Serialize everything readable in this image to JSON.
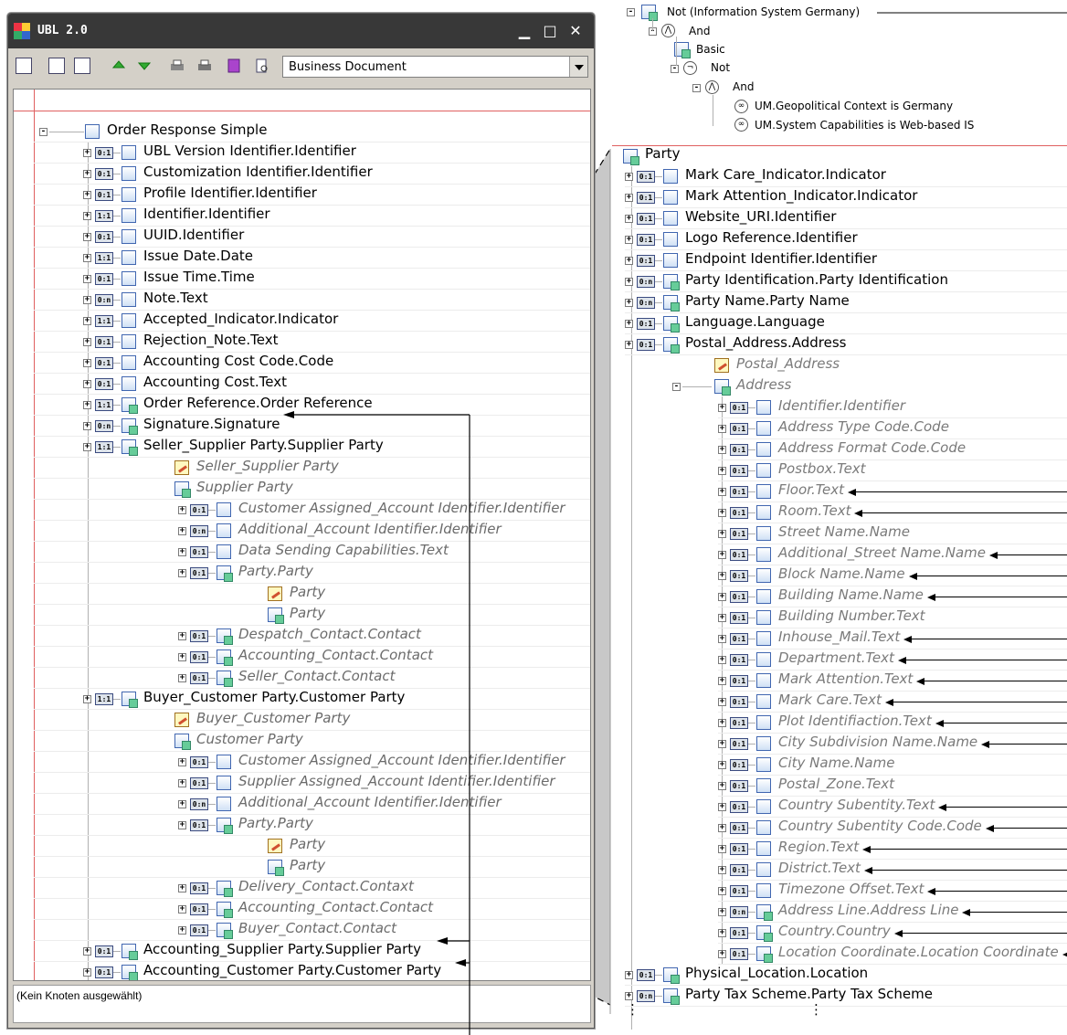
{
  "window": {
    "title": "UBL 2.0",
    "minimize": "▁",
    "maximize": "□",
    "close": "✕",
    "toolbar_icons": [
      "expand-all-icon",
      "collapse-all-icon",
      "expand-icon",
      "move-up-icon",
      "move-down-icon",
      "print-icon",
      "print-preview-icon",
      "book-icon",
      "document-view-icon"
    ],
    "document_type": "Business Document",
    "status": "(Kein Knoten ausgewählt)"
  },
  "tree": {
    "root": "Order Response Simple",
    "items": [
      {
        "card": "0:1",
        "label": "UBL Version Identifier.Identifier"
      },
      {
        "card": "0:1",
        "label": "Customization Identifier.Identifier"
      },
      {
        "card": "0:1",
        "label": "Profile Identifier.Identifier"
      },
      {
        "card": "1:1",
        "label": "Identifier.Identifier"
      },
      {
        "card": "0:1",
        "label": "UUID.Identifier"
      },
      {
        "card": "1:1",
        "label": "Issue Date.Date"
      },
      {
        "card": "0:1",
        "label": "Issue Time.Time"
      },
      {
        "card": "0:n",
        "label": "Note.Text"
      },
      {
        "card": "1:1",
        "label": "Accepted_Indicator.Indicator"
      },
      {
        "card": "0:1",
        "label": "Rejection_Note.Text"
      },
      {
        "card": "0:1",
        "label": "Accounting Cost Code.Code"
      },
      {
        "card": "0:1",
        "label": "Accounting Cost.Text"
      },
      {
        "card": "1:1",
        "label": "Order Reference.Order Reference"
      },
      {
        "card": "0:n",
        "label": "Signature.Signature"
      },
      {
        "card": "1:1",
        "label": "Seller_Supplier Party.Supplier Party"
      }
    ],
    "seller": {
      "ed_label": "Seller_Supplier Party",
      "bie_label": "Supplier Party",
      "children": [
        {
          "card": "0:1",
          "label": "Customer Assigned_Account Identifier.Identifier"
        },
        {
          "card": "0:n",
          "label": "Additional_Account Identifier.Identifier"
        },
        {
          "card": "0:1",
          "label": "Data Sending Capabilities.Text"
        },
        {
          "card": "0:1",
          "label": "Party.Party"
        }
      ],
      "party_ed": "Party",
      "party_bie": "Party",
      "children2": [
        {
          "card": "0:1",
          "label": "Despatch_Contact.Contact"
        },
        {
          "card": "0:1",
          "label": "Accounting_Contact.Contact"
        },
        {
          "card": "0:1",
          "label": "Seller_Contact.Contact"
        }
      ]
    },
    "buyer_item": {
      "card": "1:1",
      "label": "Buyer_Customer Party.Customer Party"
    },
    "buyer": {
      "ed_label": "Buyer_Customer Party",
      "bie_label": "Customer Party",
      "children": [
        {
          "card": "0:1",
          "label": "Customer Assigned_Account Identifier.Identifier"
        },
        {
          "card": "0:1",
          "label": "Supplier Assigned_Account Identifier.Identifier"
        },
        {
          "card": "0:n",
          "label": "Additional_Account Identifier.Identifier"
        },
        {
          "card": "0:1",
          "label": "Party.Party"
        }
      ],
      "party_ed": "Party",
      "party_bie": "Party",
      "children2": [
        {
          "card": "0:1",
          "label": "Delivery_Contact.Contaxt"
        },
        {
          "card": "0:1",
          "label": "Accounting_Contact.Contact"
        },
        {
          "card": "0:1",
          "label": "Buyer_Contact.Contact"
        }
      ]
    },
    "tail": [
      {
        "card": "0:1",
        "label": "Accounting_Supplier Party.Supplier Party"
      },
      {
        "card": "0:1",
        "label": "Accounting_Customer Party.Customer Party"
      }
    ]
  },
  "context": {
    "not_label": "Not (Information System Germany)",
    "and1": "And",
    "basic": "Basic",
    "not2": "Not",
    "and2": "And",
    "cond1": "UM.Geopolitical Context is Germany",
    "cond2": "UM.System Capabilities is Web-based IS",
    "op_and_symbol": "⋀",
    "op_not_symbol": "¬",
    "cond_symbol": "∞"
  },
  "party": {
    "title": "Party",
    "items": [
      {
        "card": "0:1",
        "label": "Mark Care_Indicator.Indicator"
      },
      {
        "card": "0:1",
        "label": "Mark Attention_Indicator.Indicator"
      },
      {
        "card": "0:1",
        "label": "Website_URI.Identifier"
      },
      {
        "card": "0:1",
        "label": "Logo Reference.Identifier"
      },
      {
        "card": "0:1",
        "label": "Endpoint Identifier.Identifier"
      },
      {
        "card": "0:n",
        "label": "Party Identification.Party Identification"
      },
      {
        "card": "0:n",
        "label": "Party Name.Party Name"
      },
      {
        "card": "0:1",
        "label": "Language.Language"
      },
      {
        "card": "0:1",
        "label": "Postal_Address.Address"
      }
    ],
    "postal_ed": "Postal_Address",
    "address_bie": "Address",
    "address_items": [
      {
        "card": "0:1",
        "label": "Identifier.Identifier",
        "arrow": false
      },
      {
        "card": "0:1",
        "label": "Address Type Code.Code",
        "arrow": false
      },
      {
        "card": "0:1",
        "label": "Address Format Code.Code",
        "arrow": false
      },
      {
        "card": "0:1",
        "label": "Postbox.Text",
        "arrow": false
      },
      {
        "card": "0:1",
        "label": "Floor.Text",
        "arrow": true
      },
      {
        "card": "0:1",
        "label": "Room.Text",
        "arrow": true
      },
      {
        "card": "0:1",
        "label": "Street Name.Name",
        "arrow": false
      },
      {
        "card": "0:1",
        "label": "Additional_Street Name.Name",
        "arrow": true
      },
      {
        "card": "0:1",
        "label": "Block Name.Name",
        "arrow": true
      },
      {
        "card": "0:1",
        "label": "Building Name.Name",
        "arrow": true
      },
      {
        "card": "0:1",
        "label": "Building Number.Text",
        "arrow": false
      },
      {
        "card": "0:1",
        "label": "Inhouse_Mail.Text",
        "arrow": true
      },
      {
        "card": "0:1",
        "label": "Department.Text",
        "arrow": true
      },
      {
        "card": "0:1",
        "label": "Mark Attention.Text",
        "arrow": true
      },
      {
        "card": "0:1",
        "label": "Mark Care.Text",
        "arrow": true
      },
      {
        "card": "0:1",
        "label": "Plot Identifiaction.Text",
        "arrow": true
      },
      {
        "card": "0:1",
        "label": "City Subdivision Name.Name",
        "arrow": true
      },
      {
        "card": "0:1",
        "label": "City Name.Name",
        "arrow": false
      },
      {
        "card": "0:1",
        "label": "Postal_Zone.Text",
        "arrow": false
      },
      {
        "card": "0:1",
        "label": "Country Subentity.Text",
        "arrow": true
      },
      {
        "card": "0:1",
        "label": "Country Subentity Code.Code",
        "arrow": true
      },
      {
        "card": "0:1",
        "label": "Region.Text",
        "arrow": true
      },
      {
        "card": "0:1",
        "label": "District.Text",
        "arrow": true
      },
      {
        "card": "0:1",
        "label": "Timezone Offset.Text",
        "arrow": true
      },
      {
        "card": "0:n",
        "label": "Address Line.Address Line",
        "arrow": true
      },
      {
        "card": "0:1",
        "label": "Country.Country",
        "arrow": true
      },
      {
        "card": "0:1",
        "label": "Location Coordinate.Location Coordinate",
        "arrow": true
      }
    ],
    "tail": [
      {
        "card": "0:1",
        "label": "Physical_Location.Location"
      },
      {
        "card": "0:n",
        "label": "Party Tax Scheme.Party Tax Scheme"
      }
    ],
    "ellipsis": "⋮"
  },
  "colors": {
    "title_bar": "#383838",
    "frame": "#d4d0c8",
    "red_guide": "#e06060",
    "zoom_shade": "#c8c8c8",
    "card_border": "#3b4b80"
  }
}
